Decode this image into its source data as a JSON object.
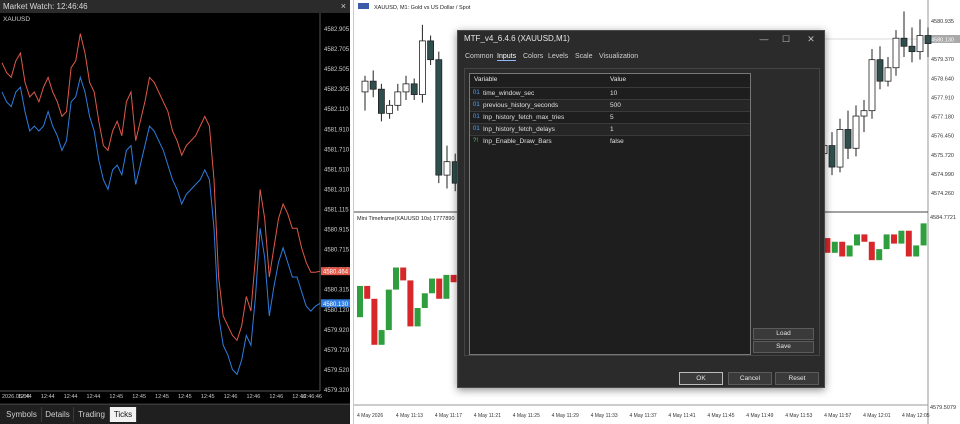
{
  "market_watch": {
    "title": "Market Watch: 12:46:46",
    "close_glyph": "×",
    "symbol": "XAUUSD",
    "price_scale": [
      "4582.905",
      "4582.705",
      "4582.505",
      "4582.305",
      "4582.110",
      "4581.910",
      "4581.710",
      "4581.510",
      "4581.310",
      "4581.115",
      "4580.915",
      "4580.715",
      "4580.515",
      "4580.315",
      "4580.120",
      "4579.920",
      "4579.720",
      "4579.520",
      "4579.320"
    ],
    "ask_label": "4580.464",
    "bid_label": "4580.130",
    "time_labels": [
      "2026.05.04",
      "12:44",
      "12:44",
      "12:44",
      "12:44",
      "12:45",
      "12:45",
      "12:45",
      "12:45",
      "12:45",
      "12:46",
      "12:46",
      "12:46",
      "12:46",
      "12:46:46"
    ],
    "tabs": [
      "Symbols",
      "Details",
      "Trading",
      "Ticks"
    ],
    "active_tab": "Ticks",
    "colors": {
      "ask": "#e0584a",
      "bid": "#2f7de1",
      "background": "#000000"
    },
    "chart_data": {
      "type": "line",
      "series": [
        {
          "name": "Ask",
          "values": [
            4582.6,
            4582.5,
            4582.45,
            4582.62,
            4582.7,
            4582.4,
            4582.25,
            4582.3,
            4582.2,
            4582.35,
            4582.45,
            4582.3,
            4582.2,
            4582.05,
            4582.1,
            4582.55,
            4582.62,
            4582.9,
            4582.7,
            4582.4,
            4582.3,
            4582.0,
            4581.75,
            4581.7,
            4581.9,
            4582.0,
            4581.85,
            4582.2,
            4582.3,
            4581.8,
            4582.0,
            4582.2,
            4582.45,
            4582.4,
            4582.3,
            4582.2,
            4582.1,
            4581.9,
            4581.8,
            4581.65,
            4581.75,
            4581.8,
            4581.85,
            4581.95,
            4582.05,
            4581.95,
            4581.4,
            4580.4,
            4580.0,
            4579.9,
            4579.8,
            4579.75,
            4579.9,
            4580.2,
            4580.05,
            4580.6,
            4581.3,
            4581.0,
            4580.4,
            4580.7,
            4581.0,
            4581.15,
            4581.05,
            4580.9,
            4580.9,
            4580.7,
            4580.55,
            4580.45,
            4580.45,
            4580.46
          ]
        },
        {
          "name": "Bid",
          "values": [
            4582.3,
            4582.2,
            4582.15,
            4582.3,
            4582.35,
            4582.1,
            4581.9,
            4581.95,
            4581.9,
            4581.95,
            4582.1,
            4581.95,
            4581.85,
            4581.7,
            4581.8,
            4582.2,
            4582.25,
            4582.45,
            4582.3,
            4582.05,
            4581.9,
            4581.6,
            4581.4,
            4581.3,
            4581.5,
            4581.55,
            4581.45,
            4581.7,
            4581.75,
            4581.35,
            4581.55,
            4581.75,
            4581.95,
            4581.9,
            4581.8,
            4581.7,
            4581.55,
            4581.4,
            4581.3,
            4581.15,
            4581.25,
            4581.3,
            4581.35,
            4581.4,
            4581.5,
            4581.4,
            4580.9,
            4580.0,
            4579.7,
            4579.6,
            4579.45,
            4579.4,
            4579.55,
            4579.8,
            4579.7,
            4580.2,
            4580.9,
            4580.6,
            4580.0,
            4580.3,
            4580.55,
            4580.7,
            4580.55,
            4580.4,
            4580.4,
            4580.25,
            4580.1,
            4580.05,
            4580.1,
            4580.13
          ]
        }
      ],
      "ylim": [
        4579.25,
        4583.05
      ]
    }
  },
  "main_chart": {
    "title": "XAUUSD, M1:  Gold vs US Dollar / Spot",
    "price_scale": [
      "4580.935",
      "4580.095",
      "4579.370",
      "4578.640",
      "4577.910",
      "4577.180",
      "4576.450",
      "4575.720",
      "4574.990",
      "4574.260"
    ],
    "current_price_label": "4580.130",
    "indicator_title": "Mini Timeframe(XAUUSD 10s) 1777890",
    "indicator_scale_top": "4584.7721",
    "indicator_scale_bottom": "4579.5079",
    "time_labels": [
      "4 May 2026",
      "4 May 11:13",
      "4 May 11:17",
      "4 May 11:21",
      "4 May 11:25",
      "4 May 11:29",
      "4 May 11:33",
      "4 May 11:37",
      "4 May 11:41",
      "4 May 11:45",
      "4 May 11:49",
      "4 May 11:53",
      "4 May 11:57",
      "4 May 12:01",
      "4 May 12:05"
    ],
    "colors": {
      "bull": "#ffffff",
      "bear": "#2f4f4f",
      "ind_bull": "#2e9e3e",
      "ind_bear": "#d8272b"
    },
    "chart_data": {
      "type": "candlestick",
      "y_unit": "price",
      "ylim": [
        4573.9,
        4581.5
      ],
      "candles_left": [
        {
          "o": 4578.3,
          "h": 4578.9,
          "l": 4577.6,
          "c": 4578.7
        },
        {
          "o": 4578.7,
          "h": 4579.1,
          "l": 4578.1,
          "c": 4578.4
        },
        {
          "o": 4578.4,
          "h": 4578.6,
          "l": 4577.2,
          "c": 4577.5
        },
        {
          "o": 4577.5,
          "h": 4578.0,
          "l": 4577.3,
          "c": 4577.8
        },
        {
          "o": 4577.8,
          "h": 4578.6,
          "l": 4577.6,
          "c": 4578.3
        },
        {
          "o": 4578.3,
          "h": 4578.9,
          "l": 4578.0,
          "c": 4578.6
        },
        {
          "o": 4578.6,
          "h": 4578.8,
          "l": 4578.0,
          "c": 4578.2
        },
        {
          "o": 4578.2,
          "h": 4580.8,
          "l": 4577.9,
          "c": 4580.2
        },
        {
          "o": 4580.2,
          "h": 4580.4,
          "l": 4579.3,
          "c": 4579.5
        },
        {
          "o": 4579.5,
          "h": 4579.8,
          "l": 4574.9,
          "c": 4575.2
        },
        {
          "o": 4575.2,
          "h": 4576.3,
          "l": 4574.7,
          "c": 4575.7
        },
        {
          "o": 4575.7,
          "h": 4576.0,
          "l": 4574.6,
          "c": 4574.9
        },
        {
          "o": 4574.9,
          "h": 4575.7,
          "l": 4574.4,
          "c": 4575.4
        }
      ],
      "candles_right": [
        {
          "o": 4576.0,
          "h": 4576.6,
          "l": 4575.6,
          "c": 4576.3
        },
        {
          "o": 4576.3,
          "h": 4576.8,
          "l": 4575.2,
          "c": 4575.5
        },
        {
          "o": 4575.5,
          "h": 4577.3,
          "l": 4575.3,
          "c": 4576.9
        },
        {
          "o": 4576.9,
          "h": 4577.6,
          "l": 4575.8,
          "c": 4576.2
        },
        {
          "o": 4576.2,
          "h": 4577.8,
          "l": 4575.9,
          "c": 4577.4
        },
        {
          "o": 4577.4,
          "h": 4578.0,
          "l": 4576.8,
          "c": 4577.6
        },
        {
          "o": 4577.6,
          "h": 4579.9,
          "l": 4577.3,
          "c": 4579.5
        },
        {
          "o": 4579.5,
          "h": 4580.0,
          "l": 4578.4,
          "c": 4578.7
        },
        {
          "o": 4578.7,
          "h": 4579.6,
          "l": 4578.5,
          "c": 4579.2
        },
        {
          "o": 4579.2,
          "h": 4580.6,
          "l": 4578.9,
          "c": 4580.3
        },
        {
          "o": 4580.3,
          "h": 4581.3,
          "l": 4579.6,
          "c": 4580.0
        },
        {
          "o": 4580.0,
          "h": 4580.7,
          "l": 4579.4,
          "c": 4579.8
        },
        {
          "o": 4579.8,
          "h": 4581.0,
          "l": 4579.5,
          "c": 4580.4
        },
        {
          "o": 4580.4,
          "h": 4580.7,
          "l": 4579.6,
          "c": 4580.1
        }
      ],
      "indicator_bars_left": [
        {
          "o": 0.45,
          "c": 0.62
        },
        {
          "o": 0.62,
          "c": 0.55
        },
        {
          "o": 0.55,
          "c": 0.3
        },
        {
          "o": 0.3,
          "c": 0.38
        },
        {
          "o": 0.38,
          "c": 0.6
        },
        {
          "o": 0.6,
          "c": 0.72
        },
        {
          "o": 0.72,
          "c": 0.65
        },
        {
          "o": 0.65,
          "c": 0.4
        },
        {
          "o": 0.4,
          "c": 0.5
        },
        {
          "o": 0.5,
          "c": 0.58
        },
        {
          "o": 0.58,
          "c": 0.66
        },
        {
          "o": 0.66,
          "c": 0.55
        },
        {
          "o": 0.55,
          "c": 0.68
        },
        {
          "o": 0.68,
          "c": 0.64
        }
      ],
      "indicator_bars_right": [
        {
          "o": 0.92,
          "c": 0.88
        },
        {
          "o": 0.88,
          "c": 0.8
        },
        {
          "o": 0.8,
          "c": 0.86
        },
        {
          "o": 0.86,
          "c": 0.78
        },
        {
          "o": 0.78,
          "c": 0.84
        },
        {
          "o": 0.84,
          "c": 0.9
        },
        {
          "o": 0.9,
          "c": 0.86
        },
        {
          "o": 0.86,
          "c": 0.76
        },
        {
          "o": 0.76,
          "c": 0.82
        },
        {
          "o": 0.82,
          "c": 0.9
        },
        {
          "o": 0.9,
          "c": 0.85
        },
        {
          "o": 0.85,
          "c": 0.92
        },
        {
          "o": 0.92,
          "c": 0.78
        },
        {
          "o": 0.78,
          "c": 0.84
        },
        {
          "o": 0.84,
          "c": 0.96
        }
      ]
    }
  },
  "dialog": {
    "title": "MTF_v4_6.4.6 (XAUUSD,M1)",
    "minimize_glyph": "—",
    "maximize_glyph": "☐",
    "close_glyph": "✕",
    "tabs": [
      "Common",
      "Inputs",
      "Colors",
      "Levels",
      "Scale",
      "Visualization"
    ],
    "active_tab": "Inputs",
    "columns": {
      "variable": "Variable",
      "value": "Value"
    },
    "rows": [
      {
        "icon": "01",
        "variable": "time_window_sec",
        "value": "10"
      },
      {
        "icon": "01",
        "variable": "previous_history_seconds",
        "value": "500"
      },
      {
        "icon": "01",
        "variable": "Inp_history_fetch_max_tries",
        "value": "5"
      },
      {
        "icon": "01",
        "variable": "Inp_history_fetch_delays",
        "value": "1"
      },
      {
        "icon": "?!",
        "variable": "Inp_Enable_Draw_Bars",
        "value": "false"
      }
    ],
    "load_label": "Load",
    "save_label": "Save",
    "ok_label": "OK",
    "cancel_label": "Cancel",
    "reset_label": "Reset"
  }
}
